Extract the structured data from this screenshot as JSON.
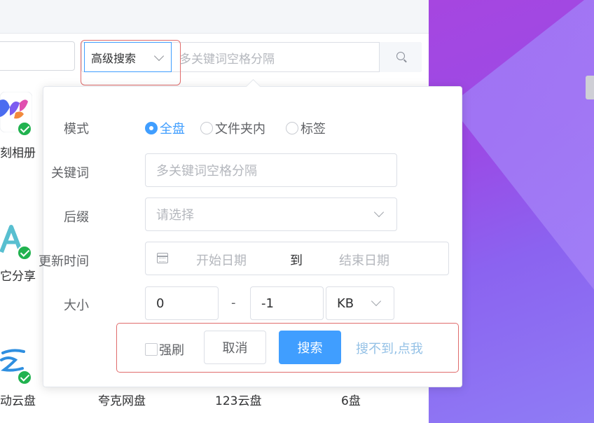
{
  "search_bar": {
    "mode_select": "高级搜索",
    "keyword_placeholder": "多关键词空格分隔"
  },
  "apps": [
    {
      "label": "刻相册",
      "installed": true
    },
    {
      "label": "它分享",
      "installed": true
    },
    {
      "label": "动云盘",
      "installed": true
    },
    {
      "label": "夸克网盘",
      "installed": false
    },
    {
      "label": "123云盘",
      "installed": false
    },
    {
      "label": "6盘",
      "installed": false
    }
  ],
  "advanced": {
    "mode_label": "模式",
    "mode_options": [
      "全盘",
      "文件夹内",
      "标签"
    ],
    "mode_selected": "全盘",
    "keyword_label": "关键词",
    "keyword_placeholder": "多关键词空格分隔",
    "suffix_label": "后缀",
    "suffix_placeholder": "请选择",
    "time_label": "更新时间",
    "start_placeholder": "开始日期",
    "range_separator": "到",
    "end_placeholder": "结束日期",
    "size_label": "大小",
    "size_min": "0",
    "size_dash": "-",
    "size_max": "-1",
    "size_unit": "KB",
    "force_refresh_label": "强刷",
    "cancel_label": "取消",
    "search_label": "搜索",
    "help_link": "搜不到,点我"
  },
  "colors": {
    "primary": "#409eff",
    "highlight_outline": "#e06c6c",
    "installed_check": "#21b24f",
    "link": "#94c1e6"
  }
}
